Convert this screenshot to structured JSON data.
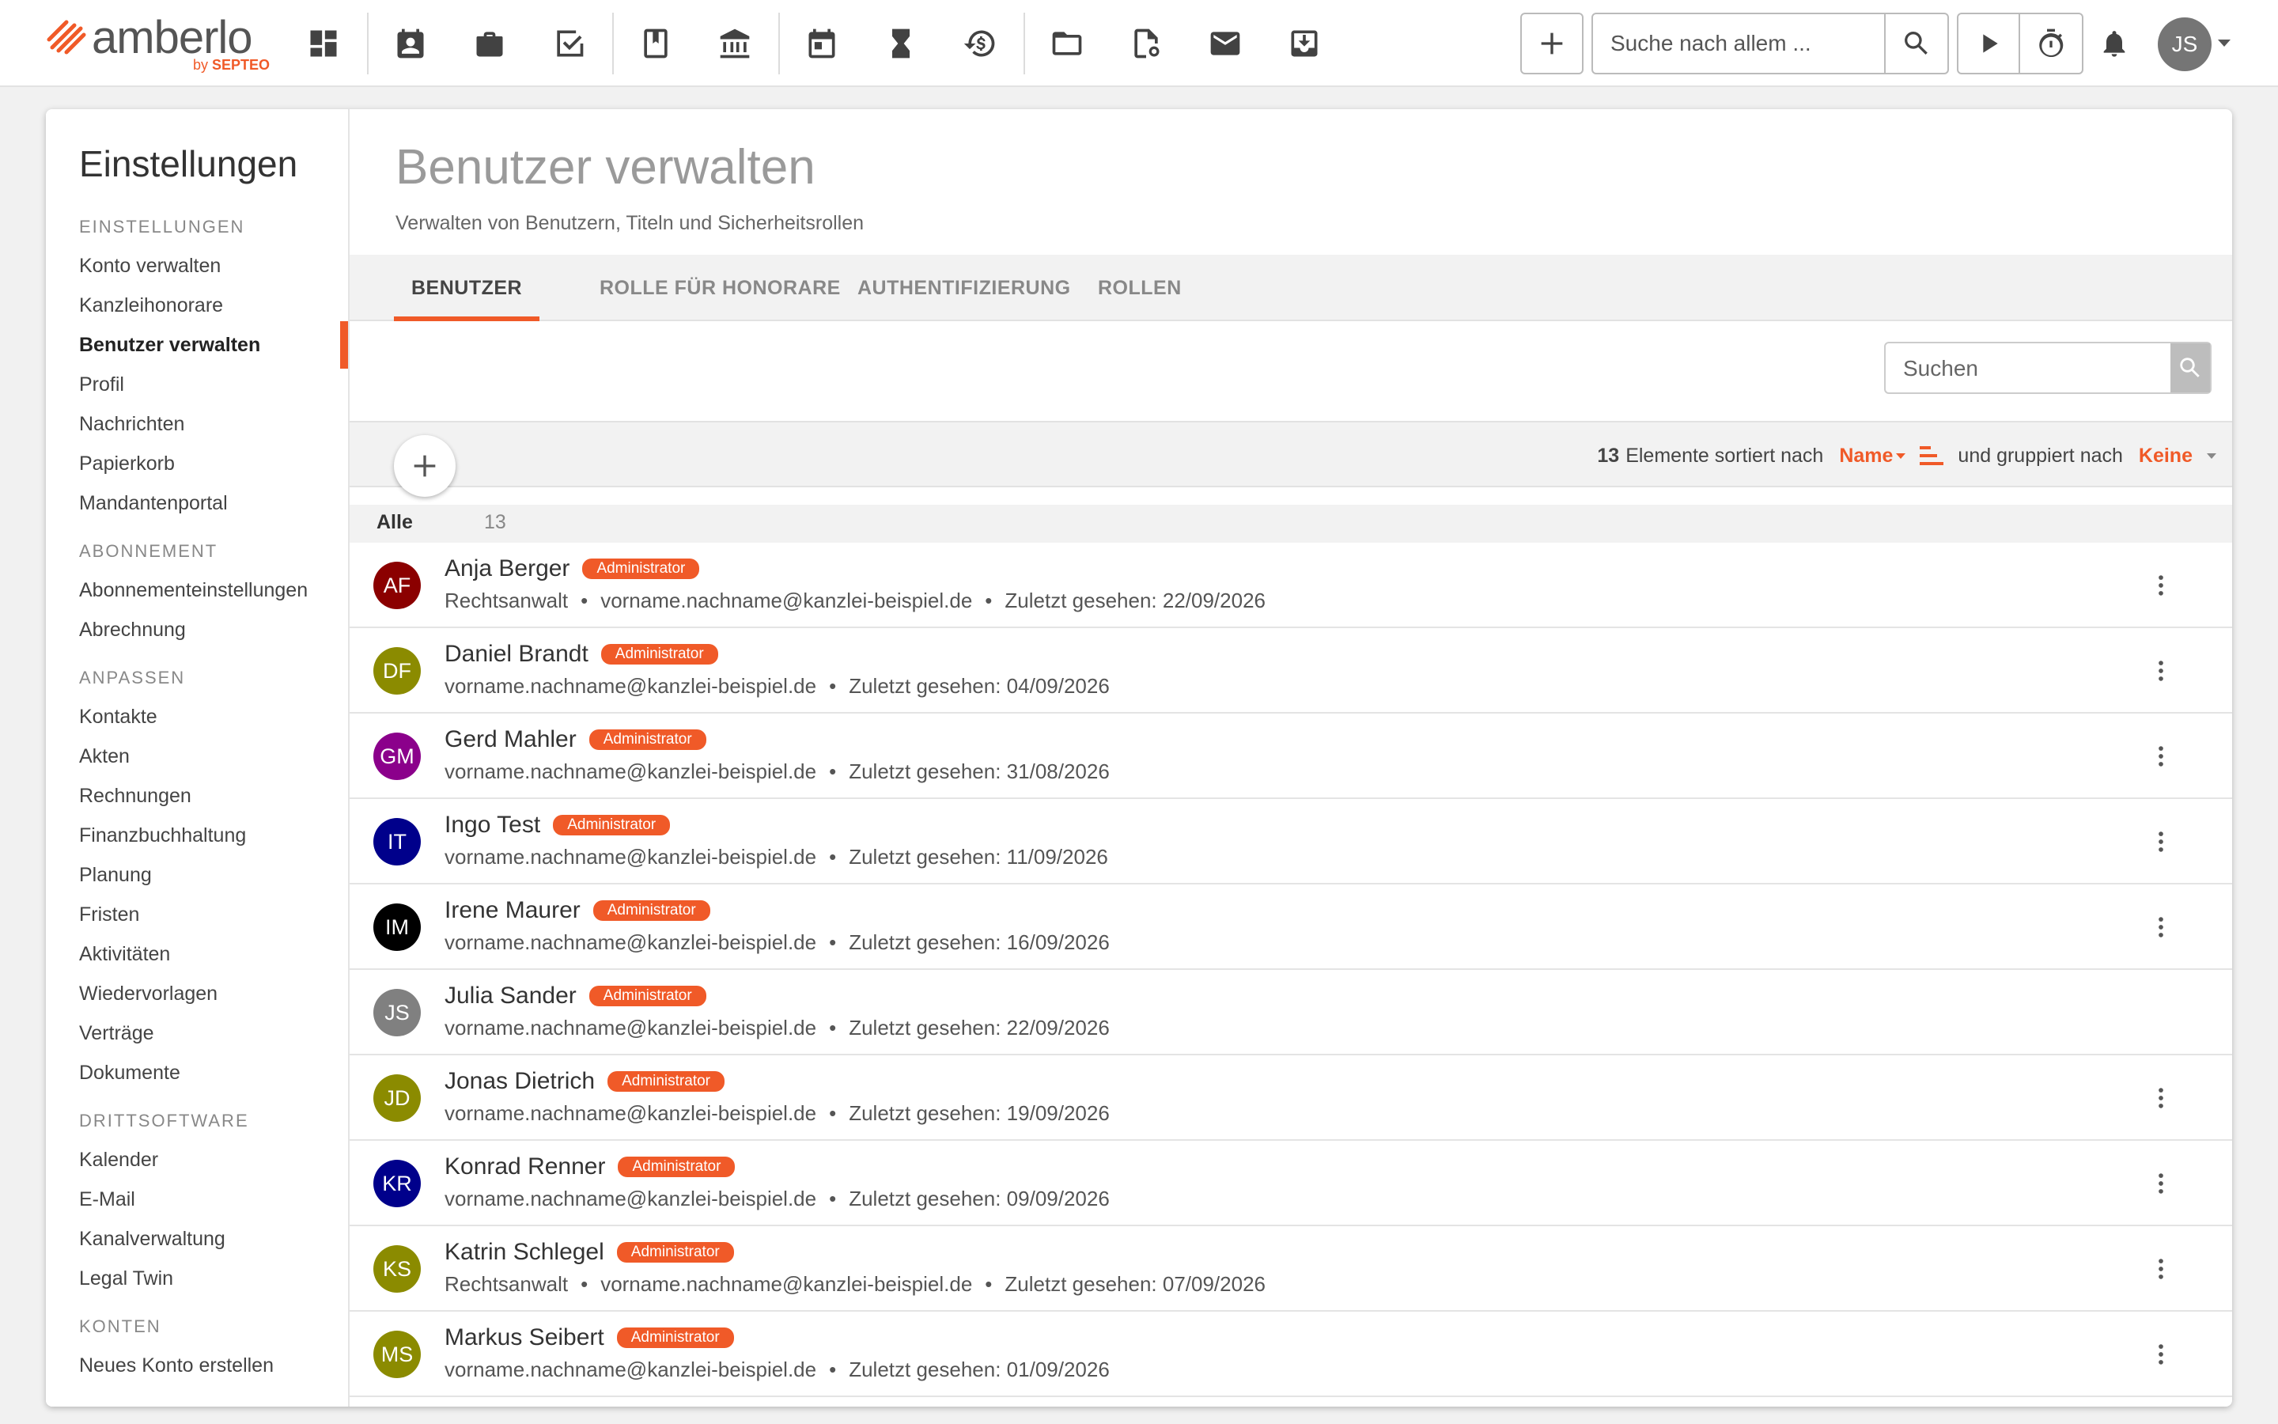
{
  "app": {
    "brand": "amberlo",
    "by": "by",
    "by_brand": "SEPTEO",
    "search_placeholder": "Suche nach allem ...",
    "user_initials": "JS",
    "accent_color": "#f05a28"
  },
  "toolbar_icons": [
    "dashboard-icon",
    "contacts-icon",
    "briefcase-icon",
    "tasks-check-icon",
    "book-icon",
    "bank-icon",
    "calendar-icon",
    "hourglass-icon",
    "billing-clock-icon",
    "folder-icon",
    "document-seal-icon",
    "mail-icon",
    "inbox-download-icon"
  ],
  "sidebar": {
    "title": "Einstellungen",
    "sections": [
      {
        "label": "EINSTELLUNGEN",
        "items": [
          "Konto verwalten",
          "Kanzleihonorare",
          "Benutzer verwalten",
          "Profil",
          "Nachrichten",
          "Papierkorb",
          "Mandantenportal"
        ]
      },
      {
        "label": "ABONNEMENT",
        "items": [
          "Abonnementeinstellungen",
          "Abrechnung"
        ]
      },
      {
        "label": "ANPASSEN",
        "items": [
          "Kontakte",
          "Akten",
          "Rechnungen",
          "Finanzbuchhaltung",
          "Planung",
          "Fristen",
          "Aktivitäten",
          "Wiedervorlagen",
          "Verträge",
          "Dokumente"
        ]
      },
      {
        "label": "DRITTSOFTWARE",
        "items": [
          "Kalender",
          "E-Mail",
          "Kanalverwaltung",
          "Legal Twin"
        ]
      },
      {
        "label": "KONTEN",
        "items": [
          "Neues Konto erstellen"
        ]
      }
    ],
    "active_item": "Benutzer verwalten"
  },
  "page": {
    "title": "Benutzer verwalten",
    "subtitle": "Verwalten von Benutzern, Titeln und Sicherheitsrollen"
  },
  "tabs": [
    "BENUTZER",
    "ROLLE FÜR HONORARE",
    "AUTHENTIFIZIERUNG",
    "ROLLEN"
  ],
  "active_tab": "BENUTZER",
  "list": {
    "search_placeholder": "Suchen",
    "count": "13",
    "sorted_by_text": "Elemente sortiert nach",
    "sort_field": "Name",
    "grouped_by_text": "und gruppiert nach",
    "group_field": "Keine",
    "group_label": "Alle",
    "group_count": "13"
  },
  "users": [
    {
      "initials": "AF",
      "name": "Anja Berger",
      "role": "Administrator",
      "title": "Rechtsanwalt",
      "email": "vorname.nachname@kanzlei-beispiel.de",
      "last_seen": "Zuletzt gesehen: 22/09/2026",
      "color": "#8b0000",
      "menu": true
    },
    {
      "initials": "DF",
      "name": "Daniel Brandt",
      "role": "Administrator",
      "title": "",
      "email": "vorname.nachname@kanzlei-beispiel.de",
      "last_seen": "Zuletzt gesehen: 04/09/2026",
      "color": "#8b8b00",
      "menu": true
    },
    {
      "initials": "GM",
      "name": "Gerd Mahler",
      "role": "Administrator",
      "title": "",
      "email": "vorname.nachname@kanzlei-beispiel.de",
      "last_seen": "Zuletzt gesehen: 31/08/2026",
      "color": "#8b008b",
      "menu": true
    },
    {
      "initials": "IT",
      "name": "Ingo Test",
      "role": "Administrator",
      "title": "",
      "email": "vorname.nachname@kanzlei-beispiel.de",
      "last_seen": "Zuletzt gesehen: 11/09/2026",
      "color": "#00008b",
      "menu": true
    },
    {
      "initials": "IM",
      "name": "Irene Maurer",
      "role": "Administrator",
      "title": "",
      "email": "vorname.nachname@kanzlei-beispiel.de",
      "last_seen": "Zuletzt gesehen: 16/09/2026",
      "color": "#000000",
      "menu": true
    },
    {
      "initials": "JS",
      "name": "Julia Sander",
      "role": "Administrator",
      "title": "",
      "email": "vorname.nachname@kanzlei-beispiel.de",
      "last_seen": "Zuletzt gesehen: 22/09/2026",
      "color": "#808080",
      "menu": false
    },
    {
      "initials": "JD",
      "name": "Jonas Dietrich",
      "role": "Administrator",
      "title": "",
      "email": "vorname.nachname@kanzlei-beispiel.de",
      "last_seen": "Zuletzt gesehen: 19/09/2026",
      "color": "#8b8b00",
      "menu": true
    },
    {
      "initials": "KR",
      "name": "Konrad Renner",
      "role": "Administrator",
      "title": "",
      "email": "vorname.nachname@kanzlei-beispiel.de",
      "last_seen": "Zuletzt gesehen: 09/09/2026",
      "color": "#00008b",
      "menu": true
    },
    {
      "initials": "KS",
      "name": "Katrin Schlegel",
      "role": "Administrator",
      "title": "Rechtsanwalt",
      "email": "vorname.nachname@kanzlei-beispiel.de",
      "last_seen": "Zuletzt gesehen: 07/09/2026",
      "color": "#8b8b00",
      "menu": true
    },
    {
      "initials": "MS",
      "name": "Markus Seibert",
      "role": "Administrator",
      "title": "",
      "email": "vorname.nachname@kanzlei-beispiel.de",
      "last_seen": "Zuletzt gesehen: 01/09/2026",
      "color": "#8b8b00",
      "menu": true
    }
  ]
}
